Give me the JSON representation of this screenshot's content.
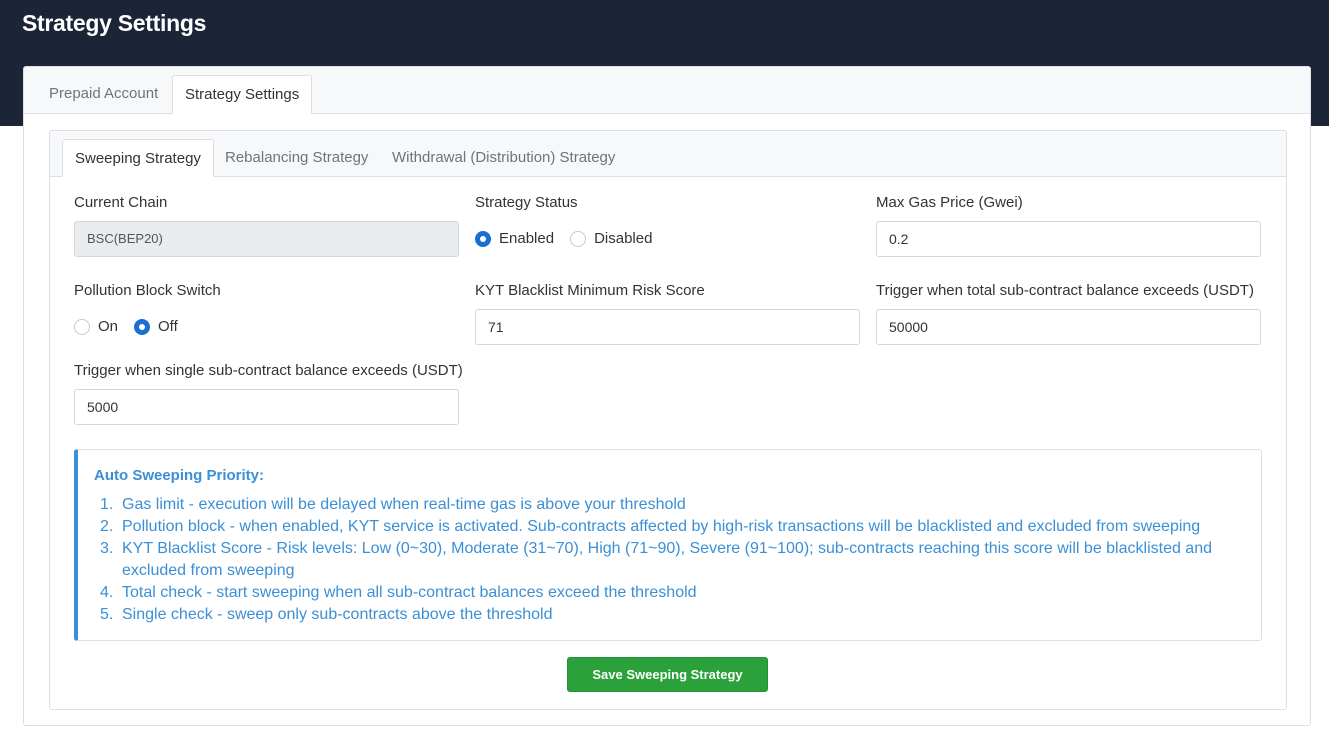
{
  "header": {
    "title": "Strategy Settings"
  },
  "outer_tabs": [
    {
      "label": "Prepaid Account",
      "active": false
    },
    {
      "label": "Strategy Settings",
      "active": true
    }
  ],
  "inner_tabs": [
    {
      "label": "Sweeping Strategy",
      "active": true
    },
    {
      "label": "Rebalancing Strategy",
      "active": false
    },
    {
      "label": "Withdrawal (Distribution) Strategy",
      "active": false
    }
  ],
  "form": {
    "current_chain": {
      "label": "Current Chain",
      "value": "BSC(BEP20)"
    },
    "strategy_status": {
      "label": "Strategy Status",
      "options": [
        {
          "label": "Enabled",
          "checked": true
        },
        {
          "label": "Disabled",
          "checked": false
        }
      ]
    },
    "max_gas_price": {
      "label": "Max Gas Price (Gwei)",
      "value": "0.2"
    },
    "pollution_block": {
      "label": "Pollution Block Switch",
      "options": [
        {
          "label": "On",
          "checked": false
        },
        {
          "label": "Off",
          "checked": true
        }
      ]
    },
    "kyt_min_risk": {
      "label": "KYT Blacklist Minimum Risk Score",
      "value": "71"
    },
    "total_trigger": {
      "label": "Trigger when total sub-contract balance exceeds (USDT)",
      "value": "50000"
    },
    "single_trigger": {
      "label": "Trigger when single sub-contract balance exceeds (USDT)",
      "value": "5000"
    }
  },
  "info": {
    "title": "Auto Sweeping Priority:",
    "items": [
      {
        "num": "1.",
        "text": "Gas limit - execution will be delayed when real-time gas is above your threshold"
      },
      {
        "num": "2.",
        "text": "Pollution block - when enabled, KYT service is activated. Sub-contracts affected by high-risk transactions will be blacklisted and excluded from sweeping"
      },
      {
        "num": "3.",
        "text": "KYT Blacklist Score - Risk levels: Low (0~30), Moderate (31~70), High (71~90), Severe (91~100); sub-contracts reaching this score will be blacklisted and excluded from sweeping"
      },
      {
        "num": "4.",
        "text": "Total check - start sweeping when all sub-contract balances exceed the threshold"
      },
      {
        "num": "5.",
        "text": "Single check - sweep only sub-contracts above the threshold"
      }
    ]
  },
  "actions": {
    "save_label": "Save Sweeping Strategy"
  },
  "colors": {
    "header_bg": "#1b2537",
    "primary": "#1a6fd1",
    "info": "#3a8fd6",
    "success": "#2aa13a"
  }
}
